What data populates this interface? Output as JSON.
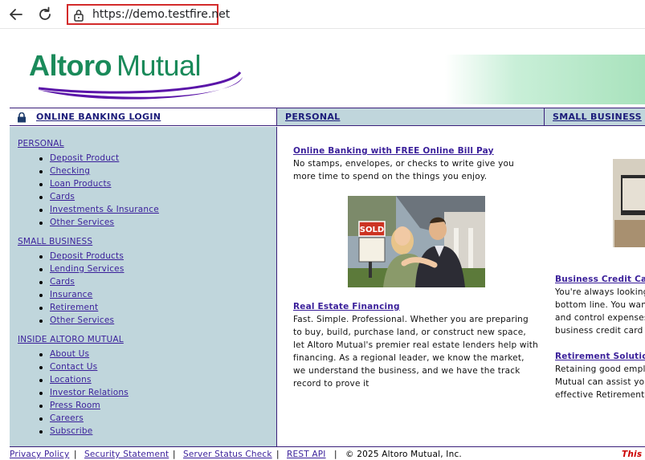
{
  "browser": {
    "url": "https://demo.testfire.net",
    "icons": {
      "back": "back-arrow-icon",
      "reload": "reload-icon",
      "lock": "lock-icon"
    }
  },
  "header": {
    "logo_text": "AltoroMutual",
    "colors": {
      "logo_green": "#1a8a5a",
      "logo_purple": "#5a14a8",
      "nav_bg": "#c0d6dc",
      "link": "#3a1f9a"
    }
  },
  "nav": {
    "login": "ONLINE BANKING LOGIN",
    "personal": "PERSONAL",
    "small_business": "SMALL BUSINESS"
  },
  "sidebar": {
    "sections": [
      {
        "title": "PERSONAL",
        "items": [
          "Deposit Product",
          "Checking",
          "Loan Products",
          "Cards",
          "Investments & Insurance",
          "Other Services"
        ]
      },
      {
        "title": "SMALL BUSINESS",
        "items": [
          "Deposit Products",
          "Lending Services",
          "Cards",
          "Insurance",
          "Retirement",
          "Other Services"
        ]
      },
      {
        "title": "INSIDE ALTORO MUTUAL",
        "items": [
          "About Us",
          "Contact Us",
          "Locations",
          "Investor Relations",
          "Press Room",
          "Careers",
          "Subscribe"
        ]
      }
    ]
  },
  "content": {
    "left": [
      {
        "title": "Online Banking with FREE Online Bill Pay",
        "text": "No stamps, envelopes, or checks to write give you more time to spend on the things you enjoy."
      },
      {
        "title": "Real Estate Financing",
        "text": "Fast. Simple. Professional. Whether you are preparing to buy, build, purchase land, or construct new space, let Altoro Mutual's premier real estate lenders help with financing. As a regional leader, we know the market, we understand the business, and we have the track record to prove it"
      }
    ],
    "right": [
      {
        "title": "Business Credit Card",
        "lines": [
          "You're always looking",
          "bottom line. You want",
          "and control expenses.",
          "business credit card a"
        ]
      },
      {
        "title": "Retirement Solution",
        "lines": [
          "Retaining good employ",
          "Mutual can assist you",
          "effective Retirement S"
        ]
      }
    ],
    "photo_sign": "SOLD"
  },
  "footer": {
    "privacy": "Privacy Policy",
    "security": "Security Statement",
    "server": "Server Status Check",
    "rest": "REST API",
    "copyright": "© 2025 Altoro Mutual, Inc.",
    "warning": "This w",
    "separator": "|"
  }
}
